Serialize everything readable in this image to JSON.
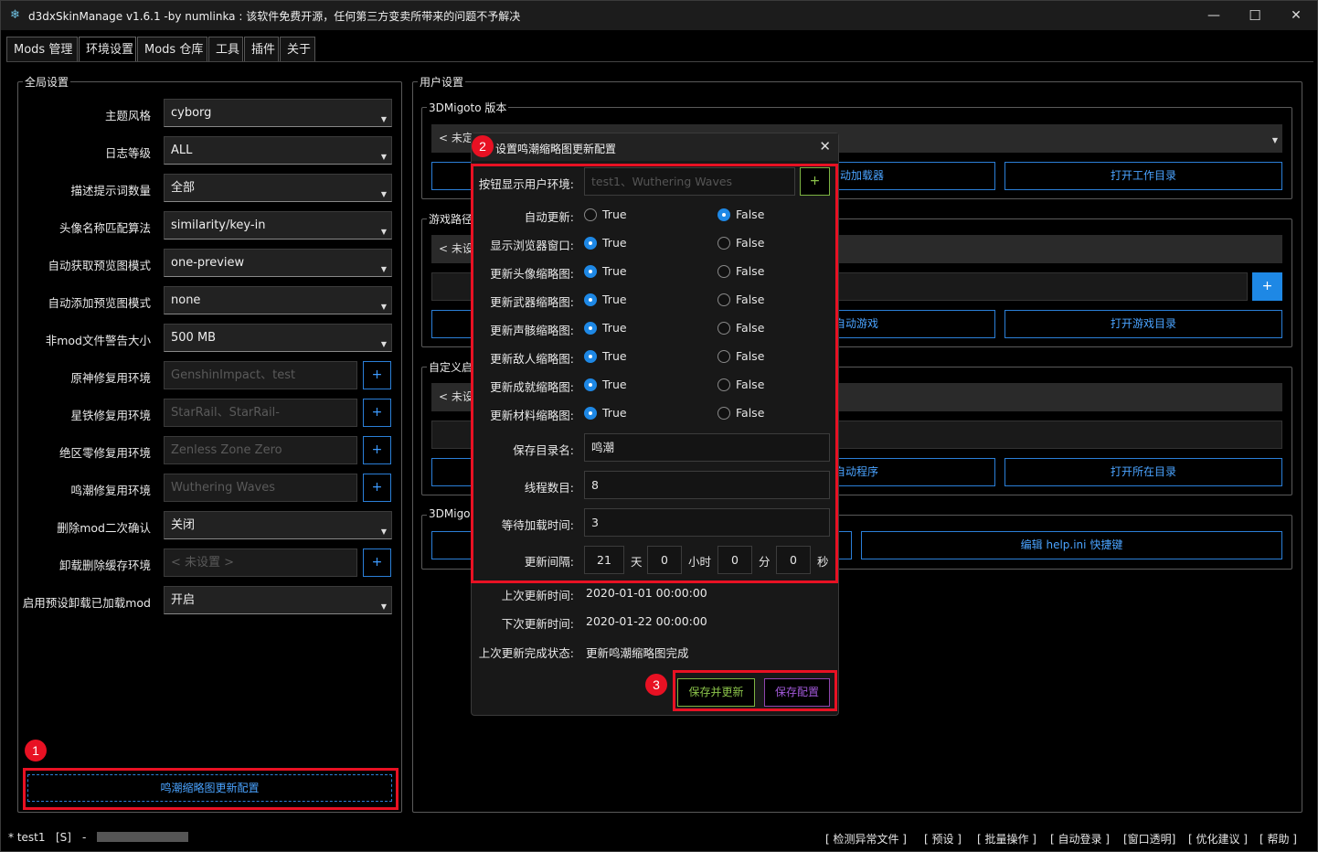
{
  "window": {
    "title": "d3dxSkinManage v1.6.1 -by numlinka : 该软件免费开源，任何第三方变卖所带来的问题不予解决",
    "minimize": "—",
    "maximize": "☐",
    "close": "✕"
  },
  "tabs": [
    "Mods 管理",
    "环境设置",
    "Mods 仓库",
    "工具",
    "插件",
    "关于"
  ],
  "global": {
    "title": "全局设置",
    "rows": [
      {
        "label": "主题风格",
        "value": "cyborg"
      },
      {
        "label": "日志等级",
        "value": "ALL"
      },
      {
        "label": "描述提示词数量",
        "value": "全部"
      },
      {
        "label": "头像名称匹配算法",
        "value": "similarity/key-in"
      },
      {
        "label": "自动获取预览图模式",
        "value": "one-preview"
      },
      {
        "label": "自动添加预览图模式",
        "value": "none"
      },
      {
        "label": "非mod文件警告大小",
        "value": "500 MB"
      },
      {
        "label": "原神修复用环境",
        "value": "GenshinImpact、test"
      },
      {
        "label": "星铁修复用环境",
        "value": "StarRail、StarRail-"
      },
      {
        "label": "绝区零修复用环境",
        "value": "Zenless Zone Zero"
      },
      {
        "label": "鸣潮修复用环境",
        "value": "Wuthering Waves"
      },
      {
        "label": "删除mod二次确认",
        "value": "关闭"
      },
      {
        "label": "卸载删除缓存环境",
        "value": "< 未设置 >"
      },
      {
        "label": "启用预设卸载已加载mod",
        "value": "开启"
      }
    ],
    "plus": "+",
    "bottom_button": "鸣潮缩略图更新配置"
  },
  "user": {
    "title": "用户设置",
    "migoto": {
      "title": "3DMigoto 版本",
      "combo": "< 未定",
      "btn_launch_tail": "动加载器",
      "btn_open": "打开工作目录"
    },
    "game": {
      "title": "游戏路径",
      "combo": "< 未设",
      "plus": "+",
      "btn_launch_tail": "自动游戏",
      "btn_open": "打开游戏目录"
    },
    "custom": {
      "title": "自定义启",
      "combo": "< 未设",
      "btn_launch_tail": "自动程序",
      "btn_open": "打开所在目录"
    },
    "migoto2": {
      "title": "3DMigo",
      "btn_help": "编辑 help.ini 快捷键"
    }
  },
  "dialog": {
    "title": "设置鸣潮缩略图更新配置",
    "close": "✕",
    "env_label": "按钮显示用户环境:",
    "env_placeholder": "test1、Wuthering Waves",
    "env_plus": "+",
    "true_label": "True",
    "false_label": "False",
    "options": [
      {
        "label": "自动更新:",
        "selected": "False"
      },
      {
        "label": "显示浏览器窗口:",
        "selected": "True"
      },
      {
        "label": "更新头像缩略图:",
        "selected": "True"
      },
      {
        "label": "更新武器缩略图:",
        "selected": "True"
      },
      {
        "label": "更新声骸缩略图:",
        "selected": "True"
      },
      {
        "label": "更新敌人缩略图:",
        "selected": "True"
      },
      {
        "label": "更新成就缩略图:",
        "selected": "True"
      },
      {
        "label": "更新材料缩略图:",
        "selected": "True"
      }
    ],
    "save_dir_label": "保存目录名:",
    "save_dir_value": "鸣潮",
    "threads_label": "线程数目:",
    "threads_value": "8",
    "wait_label": "等待加载时间:",
    "wait_value": "3",
    "interval_label": "更新间隔:",
    "interval": {
      "days": "21",
      "days_unit": "天",
      "hours": "0",
      "hours_unit": "小时",
      "minutes": "0",
      "minutes_unit": "分",
      "seconds": "0",
      "seconds_unit": "秒"
    },
    "last_update_label": "上次更新时间:",
    "last_update_value": "2020-01-01 00:00:00",
    "next_update_label": "下次更新时间:",
    "next_update_value": "2020-01-22 00:00:00",
    "last_status_label": "上次更新完成状态:",
    "last_status_value": "更新鸣潮缩略图完成",
    "btn_save_update": "保存并更新",
    "btn_save": "保存配置"
  },
  "annotations": {
    "one": "1",
    "two": "2",
    "three": "3"
  },
  "statusbar": {
    "user": "* test1",
    "flag": "[S]",
    "dash": "-",
    "links": [
      "[ 检测异常文件 ]",
      "[ 预设 ]",
      "[ 批量操作 ]",
      "[ 自动登录 ]",
      "[窗口透明]",
      "[ 优化建议 ]",
      "[ 帮助 ]"
    ]
  },
  "colors": {
    "accent_blue": "#2b7fd8",
    "annotation_red": "#e81123",
    "save_update_green": "#8bc34a",
    "save_purple": "#a259d9"
  }
}
